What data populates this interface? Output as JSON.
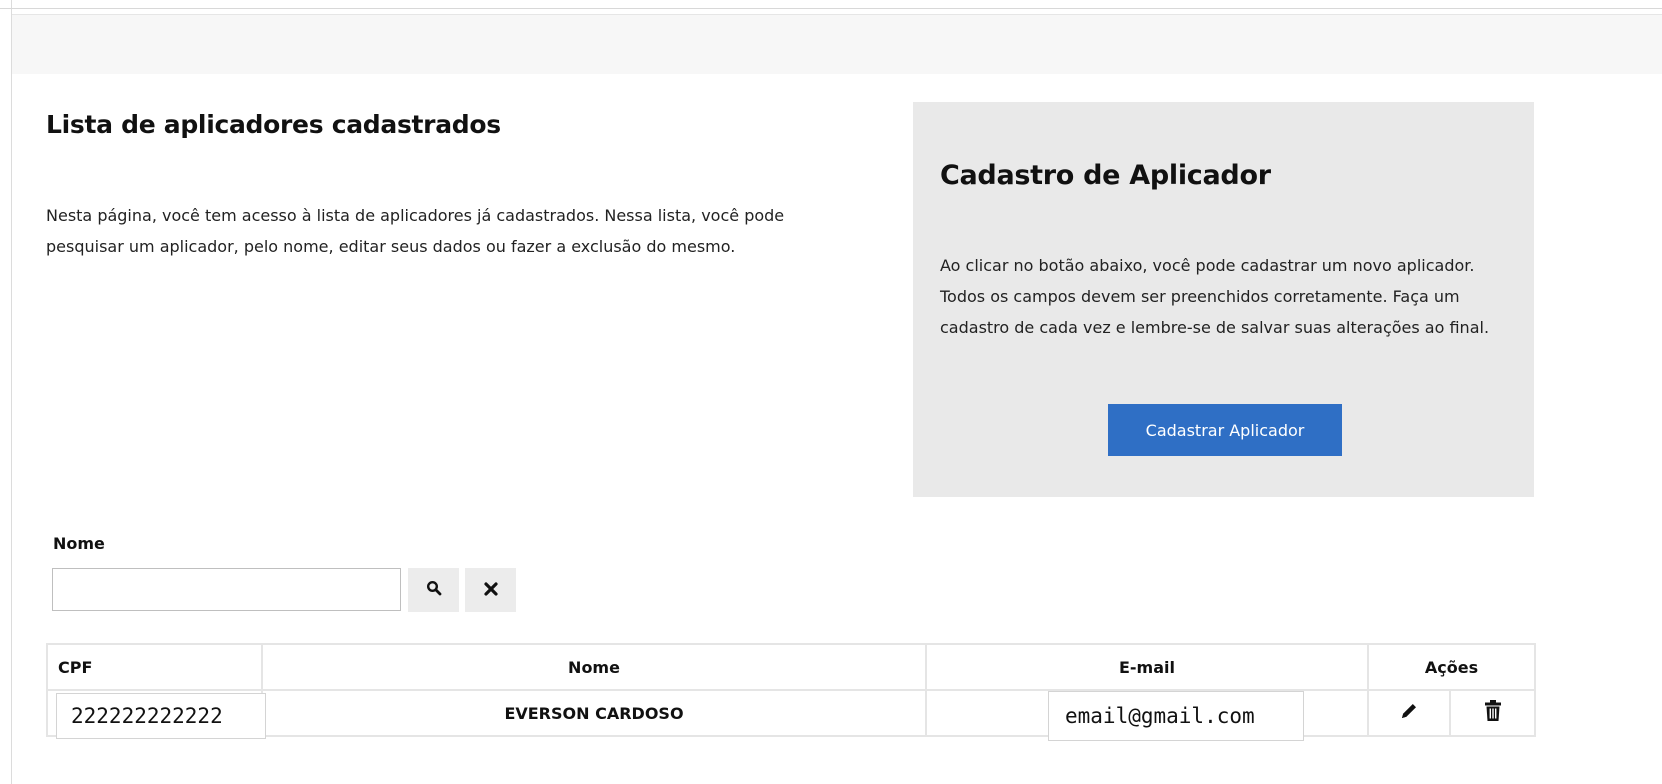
{
  "header": {
    "title": "Lista de aplicadores cadastrados",
    "description": "Nesta página, você tem acesso à lista de aplicadores já cadastrados. Nessa lista, você pode pesquisar um aplicador, pelo nome, editar seus dados ou fazer a exclusão do mesmo."
  },
  "register_panel": {
    "title": "Cadastro de Aplicador",
    "text": "Ao clicar no botão abaixo, você pode cadastrar um novo aplicador. Todos os campos devem ser preenchidos corretamente. Faça um cadastro de cada vez e lembre-se de salvar suas alterações ao final.",
    "button_label": "Cadastrar Aplicador",
    "button_color": "#2f6fc5"
  },
  "search": {
    "label": "Nome",
    "value": "",
    "placeholder": "",
    "search_icon": "search-icon",
    "clear_icon": "close-icon"
  },
  "table": {
    "columns": [
      "CPF",
      "Nome",
      "E-mail",
      "Ações"
    ],
    "rows": [
      {
        "cpf": "222222222222",
        "nome": "EVERSON CARDOSO",
        "email": "email@gmail.com",
        "edit_icon": "pencil-icon",
        "delete_icon": "trash-icon"
      }
    ]
  }
}
